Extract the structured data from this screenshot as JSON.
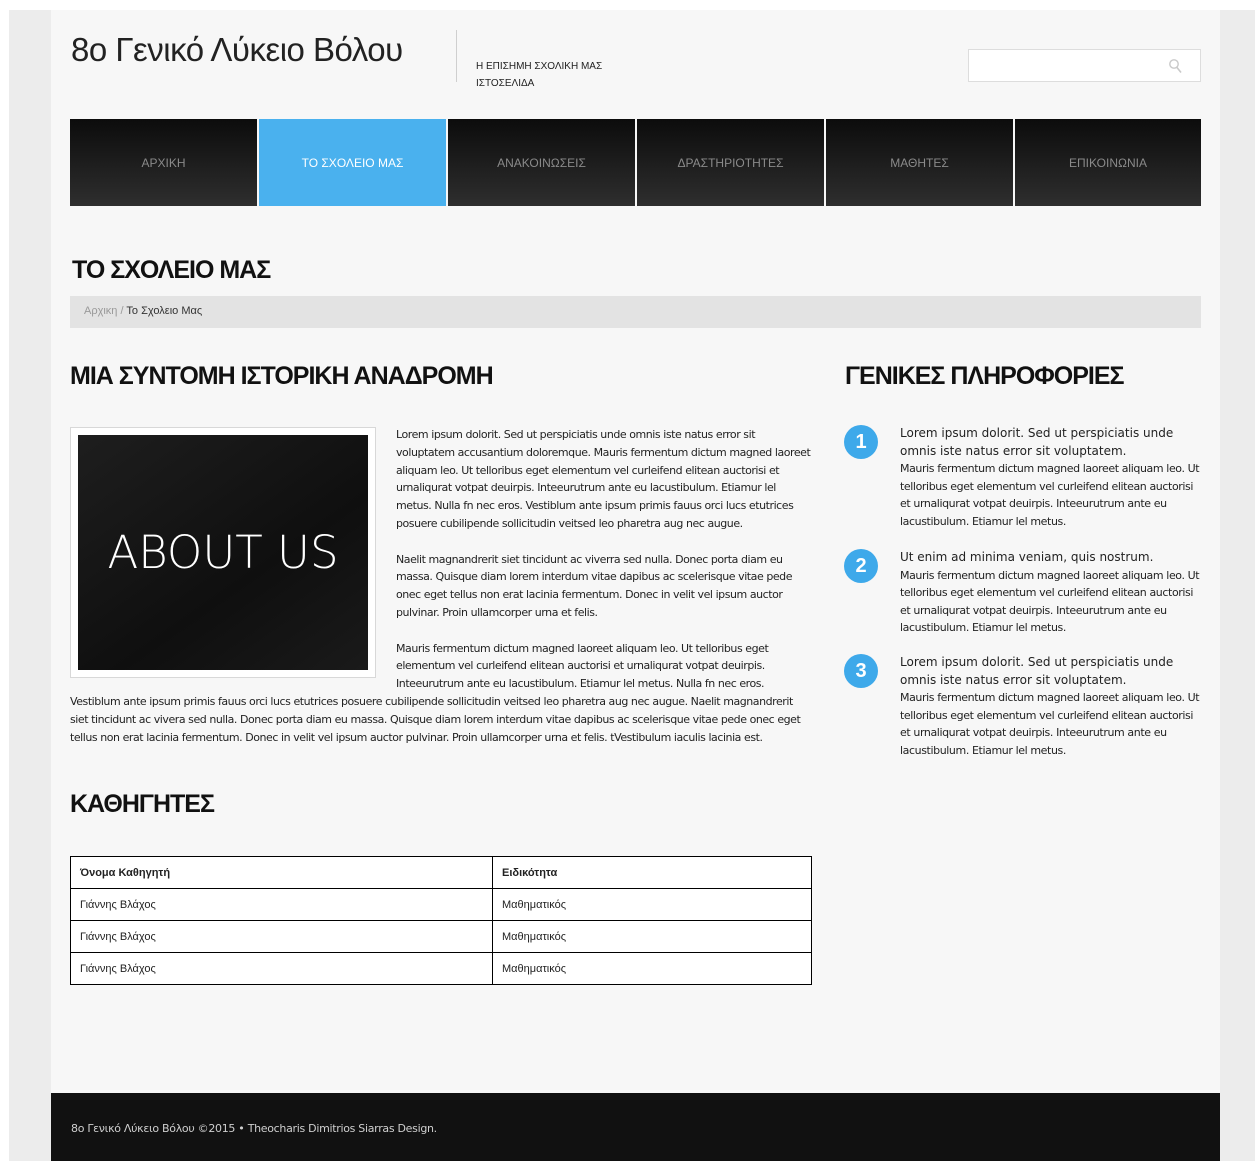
{
  "header": {
    "logo": "8ο Γενικό Λύκειο Βόλου",
    "tagline": "Η ΕΠΙΣΗΜΗ ΣΧΟΛΙΚΗ ΜΑΣ ΙΣΤΟΣΕΛΙΔΑ",
    "search_placeholder": "",
    "search_icon": "search-icon"
  },
  "nav": {
    "items": [
      "ΑΡΧΙΚΗ",
      "ΤΟ ΣΧΟΛΕΙΟ ΜΑΣ",
      "ΑΝΑΚΟΙΝΩΣΕΙΣ",
      "ΔΡΑΣΤΗΡΙΟΤΗΤΕΣ",
      "ΜΑΘΗΤΕΣ",
      "ΕΠΙΚΟΙΝΩΝΙΑ"
    ],
    "active_index": 1,
    "active_color": "#4ab1ee"
  },
  "page": {
    "title": "ΤΟ ΣΧΟΛΕΙΟ ΜΑΣ",
    "breadcrumb": {
      "home": "Αρχικη",
      "separator": " / ",
      "current": "Το Σχολειο Μας"
    }
  },
  "history": {
    "heading": "ΜΙΑ ΣΥΝΤΟΜΗ ΙΣΤΟΡΙΚΗ ΑΝΑΔΡΟΜΗ",
    "image_text": "ABOUT US",
    "paragraphs": [
      "Lorem ipsum dolorit. Sed ut perspiciatis unde omnis iste natus error sit voluptatem accusantium doloremque. Mauris fermentum dictum magned laoreet aliquam leo. Ut telloribus eget elementum vel curleifend elitean auctorisi et urnaliqurat votpat deuirpis. Inteeurutrum ante eu lacustibulum. Etiamur lel metus. Nulla fn nec eros. Vestiblum ante ipsum primis fauus orci lucs etutrices posuere cubilipende sollicitudin veitsed leo pharetra aug nec augue.",
      "Naelit magnandrerit siet tincidunt ac viverra sed nulla. Donec porta diam eu massa. Quisque diam lorem interdum vitae dapibus ac scelerisque vitae pede onec eget tellus non erat lacinia fermentum. Donec in velit vel ipsum auctor pulvinar. Proin ullamcorper urna et felis.",
      "Mauris fermentum dictum magned laoreet aliquam leo. Ut telloribus eget elementum vel curleifend elitean auctorisi et urnaliqurat votpat deuirpis. Inteeurutrum ante eu lacustibulum. Etiamur lel metus. Nulla fn nec eros. Vestiblum ante ipsum primis fauus orci lucs etutrices posuere cubilipende sollicitudin veitsed leo pharetra aug nec augue. Naelit magnandrerit siet tincidunt ac vivera sed nulla. Donec porta diam eu massa. Quisque diam lorem interdum vitae dapibus ac scelerisque vitae pede onec eget tellus non erat lacinia fermentum. Donec in velit vel ipsum auctor pulvinar. Proin ullamcorper urna et felis. tVestibulum iaculis lacinia est."
    ]
  },
  "teachers": {
    "heading": "ΚΑΘΗΓΗΤΕΣ",
    "columns": [
      "Όνομα Καθηγητή",
      "Ειδικότητα"
    ],
    "rows": [
      [
        "Γιάννης Βλάχος",
        "Μαθηματικός"
      ],
      [
        "Γιάννης Βλάχος",
        "Μαθηματικός"
      ],
      [
        "Γιάννης Βλάχος",
        "Μαθηματικός"
      ]
    ]
  },
  "info": {
    "heading": "ΓΕΝΙΚΕΣ ΠΛΗΡΟΦΟΡΙΕΣ",
    "accent": "#3ea9ea",
    "items": [
      {
        "num": "1",
        "lead": "Lorem ipsum dolorit. Sed ut perspiciatis unde omnis iste natus error sit voluptatem.",
        "body": "Mauris fermentum dictum magned laoreet aliquam leo. Ut telloribus eget elementum vel curleifend elitean auctorisi et urnaliqurat votpat deuirpis. Inteeurutrum ante eu lacustibulum. Etiamur lel metus."
      },
      {
        "num": "2",
        "lead": "Ut enim ad minima veniam, quis nostrum.",
        "body": "Mauris fermentum dictum magned laoreet aliquam leo. Ut telloribus eget elementum vel curleifend elitean auctorisi et urnaliqurat votpat deuirpis. Inteeurutrum ante eu lacustibulum. Etiamur lel metus."
      },
      {
        "num": "3",
        "lead": "Lorem ipsum dolorit. Sed ut perspiciatis unde omnis iste natus error sit voluptatem.",
        "body": "Mauris fermentum dictum magned laoreet aliquam leo. Ut telloribus eget elementum vel curleifend elitean auctorisi et urnaliqurat votpat deuirpis. Inteeurutrum ante eu lacustibulum. Etiamur lel metus."
      }
    ]
  },
  "footer": {
    "text": "8ο Γενικό Λύκειο Βόλου ©2015 • Theocharis Dimitrios Siarras Design."
  }
}
